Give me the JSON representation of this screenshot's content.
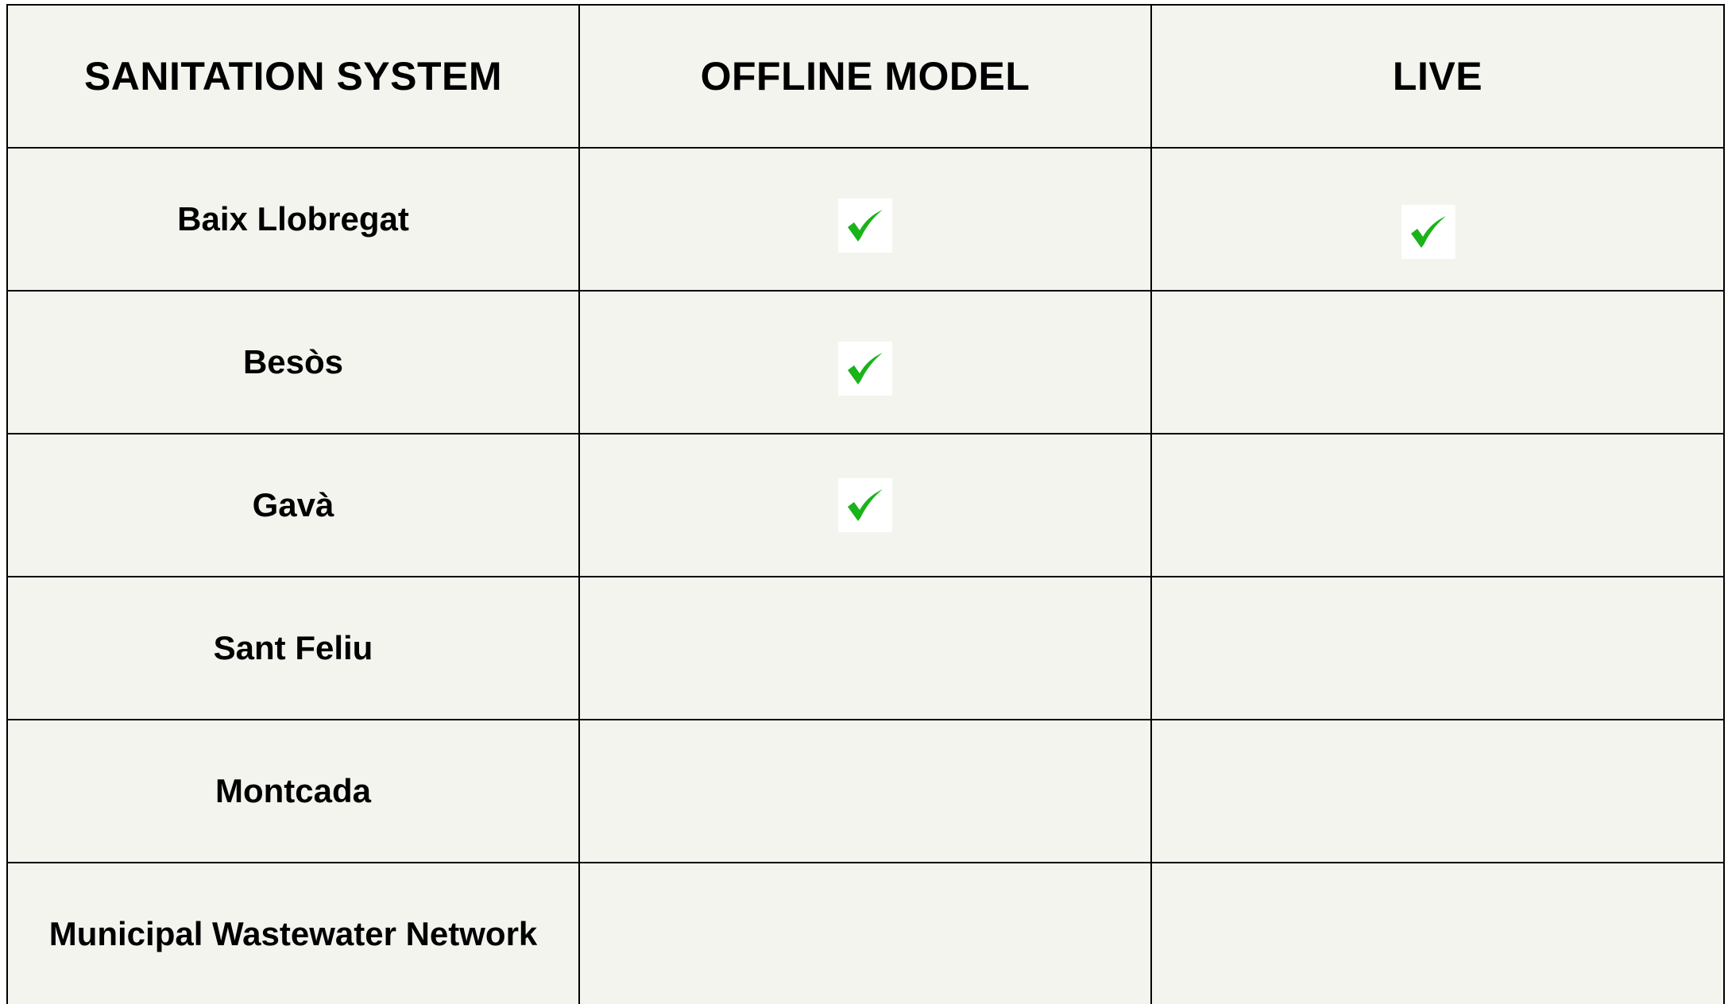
{
  "table": {
    "headers": {
      "system": "SANITATION SYSTEM",
      "offline_model": "OFFLINE MODEL",
      "live": "LIVE"
    },
    "rows": [
      {
        "name": "Baix Llobregat",
        "offline_model": true,
        "live": true
      },
      {
        "name": "Besòs",
        "offline_model": true,
        "live": false
      },
      {
        "name": "Gavà",
        "offline_model": true,
        "live": false
      },
      {
        "name": "Sant Feliu",
        "offline_model": false,
        "live": false
      },
      {
        "name": "Montcada",
        "offline_model": false,
        "live": false
      },
      {
        "name": "Municipal Wastewater Network",
        "offline_model": false,
        "live": false
      }
    ]
  },
  "colors": {
    "table_background": "#f4f4ef",
    "border": "#000000",
    "check_mark": "#1ab31a",
    "check_background": "#ffffff"
  },
  "icons": {
    "check": "check-mark-icon"
  }
}
